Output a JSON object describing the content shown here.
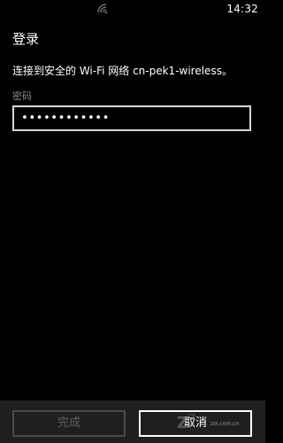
{
  "status_bar": {
    "time": "14:32",
    "signal_icon": "wifi-icon"
  },
  "dialog": {
    "title": "登录",
    "message": "连接到安全的 Wi-Fi 网络 cn-pek1-wireless。",
    "password_label": "密码",
    "password_value": "••••••••••••"
  },
  "app_bar": {
    "done_label": "完成",
    "cancel_label": "取消"
  },
  "watermark": {
    "text": "zol.com.cn"
  },
  "colors": {
    "background": "#000000",
    "app_bar": "#1f1f1f",
    "field_border": "#d6d6d6",
    "label_gray": "#8a8a8a",
    "disabled_text": "#5e5e5e"
  }
}
